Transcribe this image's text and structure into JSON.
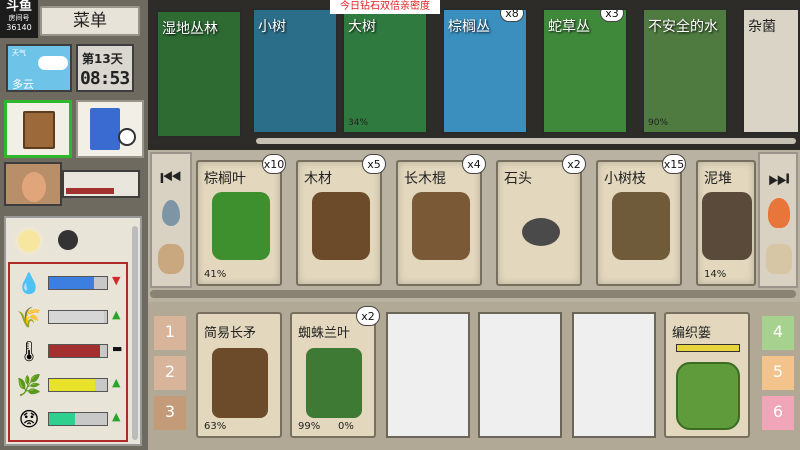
{
  "watermark": {
    "brand": "斗鱼",
    "room_label": "房间号",
    "room_id": "36140"
  },
  "menu": {
    "label": "菜单"
  },
  "weather": {
    "label": "天气",
    "condition": "多云"
  },
  "clock": {
    "day": "第13天",
    "time": "08:53"
  },
  "banner": {
    "text": "今日钻石双倍亲密度"
  },
  "locations": [
    {
      "name": "湿地丛林",
      "count": "",
      "pct": ""
    },
    {
      "name": "小树",
      "count": "",
      "pct": ""
    },
    {
      "name": "大树",
      "count": "",
      "pct": "34%"
    },
    {
      "name": "棕榈丛",
      "count": "x8",
      "pct": ""
    },
    {
      "name": "蛇草丛",
      "count": "x3",
      "pct": ""
    },
    {
      "name": "不安全的水",
      "count": "",
      "pct": "90%"
    },
    {
      "name": "杂菌",
      "count": "",
      "pct": ""
    }
  ],
  "items": [
    {
      "name": "棕榈叶",
      "count": "x10",
      "pct": "41%"
    },
    {
      "name": "木材",
      "count": "x5",
      "pct": ""
    },
    {
      "name": "长木棍",
      "count": "x4",
      "pct": ""
    },
    {
      "name": "石头",
      "count": "x2",
      "pct": ""
    },
    {
      "name": "小树枝",
      "count": "x15",
      "pct": ""
    },
    {
      "name": "泥堆",
      "count": "",
      "pct": "14%"
    }
  ],
  "crafts": [
    {
      "name": "简易长矛",
      "count": "",
      "pct": "63%",
      "pct2": ""
    },
    {
      "name": "蜘蛛兰叶",
      "count": "x2",
      "pct": "99%",
      "pct2": "0%"
    }
  ],
  "station": {
    "name": "编织篓"
  },
  "tabs_left": [
    "1",
    "2",
    "3"
  ],
  "tabs_right": [
    "4",
    "5",
    "6"
  ],
  "stats": [
    {
      "icon": "💧",
      "value": 0.78,
      "color": "#3d7fe0",
      "trend": "▼",
      "trend_color": "#d12a2a"
    },
    {
      "icon": "🌾",
      "value": 0.95,
      "color": "#d6d6d6",
      "trend": "▲",
      "trend_color": "#2aa52a"
    },
    {
      "icon": "🌡",
      "value": 0.88,
      "color": "#a32f2f",
      "trend": "▬",
      "trend_color": "#111"
    },
    {
      "icon": "🌿",
      "value": 0.8,
      "color": "#e9e22a",
      "trend": "▲",
      "trend_color": "#2aa52a"
    },
    {
      "icon": "😟",
      "value": 0.45,
      "color": "#2fcf8f",
      "trend": "▲",
      "trend_color": "#2aa52a"
    }
  ]
}
